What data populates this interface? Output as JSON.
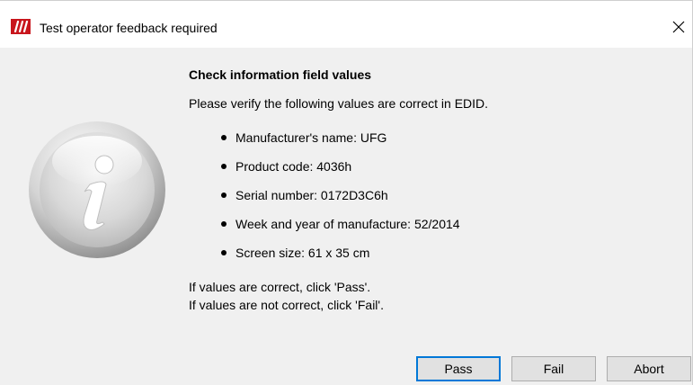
{
  "window": {
    "title": "Test operator feedback required",
    "app_icon": "app-logo-icon",
    "close_icon": "close-icon",
    "accent_color": "#c8161d"
  },
  "dialog": {
    "icon": "info-icon",
    "heading": "Check information field values",
    "intro": "Please verify the following values are correct in EDID.",
    "values": [
      "Manufacturer's name: UFG",
      "Product code: 4036h",
      "Serial number: 0172D3C6h",
      "Week and year of manufacture: 52/2014",
      "Screen size: 61 x 35 cm"
    ],
    "instructions": [
      "If values are correct, click 'Pass'.",
      "If values are not correct, click 'Fail'."
    ]
  },
  "buttons": {
    "pass": "Pass",
    "fail": "Fail",
    "abort": "Abort",
    "default_border_color": "#0078d7"
  }
}
